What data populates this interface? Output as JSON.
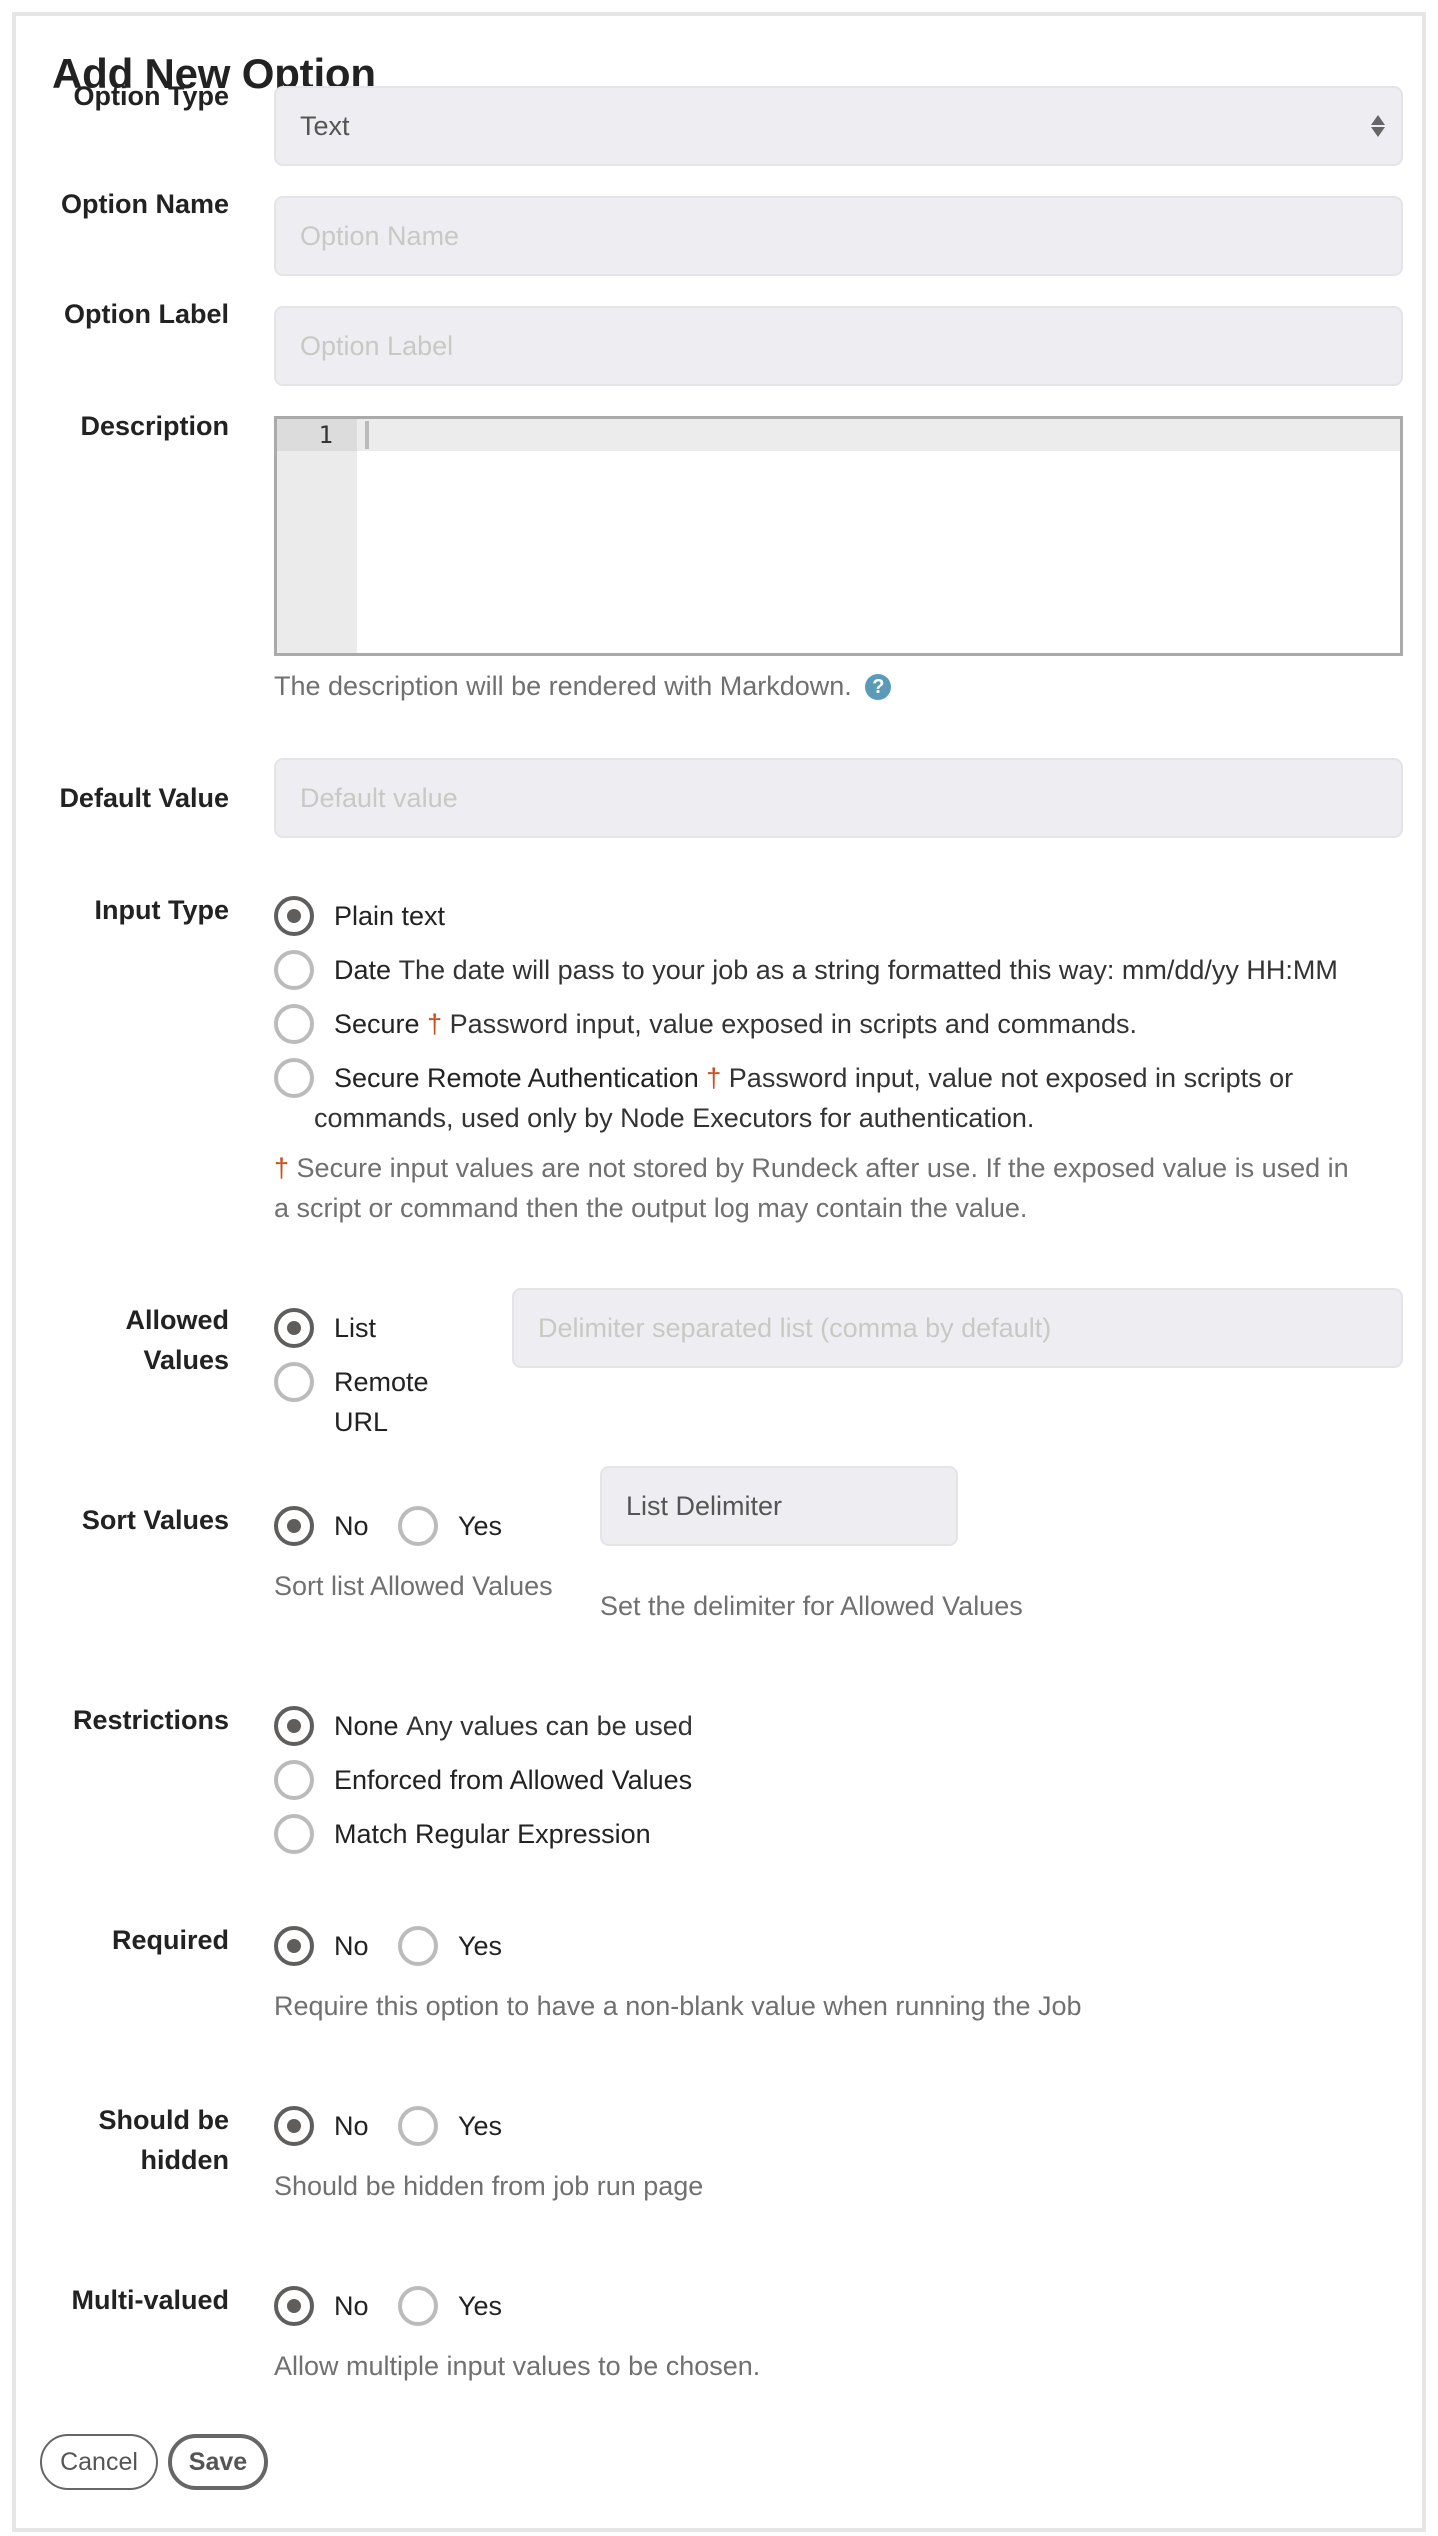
{
  "title": "Add New Option",
  "fields": {
    "option_type": {
      "label": "Option Type",
      "value": "Text"
    },
    "option_name": {
      "label": "Option Name",
      "placeholder": "Option Name",
      "value": ""
    },
    "option_label": {
      "label": "Option Label",
      "placeholder": "Option Label",
      "value": ""
    },
    "description": {
      "label": "Description",
      "line_number": "1",
      "help": "The description will be rendered with Markdown.",
      "help_icon": "question-circle-icon"
    },
    "default_value": {
      "label": "Default Value",
      "placeholder": "Default value",
      "value": ""
    },
    "input_type": {
      "label": "Input Type",
      "options": [
        {
          "label": "Plain text",
          "description": "",
          "dagger": false,
          "checked": true
        },
        {
          "label": "Date",
          "description": "The date will pass to your job as a string formatted this way: mm/dd/yy HH:MM",
          "dagger": false,
          "checked": false
        },
        {
          "label": "Secure",
          "description": "Password input, value exposed in scripts and commands.",
          "dagger": true,
          "checked": false
        },
        {
          "label": "Secure Remote Authentication",
          "description": "Password input, value not exposed in scripts or",
          "description_cont": "commands, used only by Node Executors for authentication.",
          "dagger": true,
          "checked": false
        }
      ],
      "dagger_symbol": "†",
      "note_line1": "Secure input values are not stored by Rundeck after use. If the exposed value is used in",
      "note_line2": "a script or command then the output log may contain the value."
    },
    "allowed_values": {
      "label_line1": "Allowed",
      "label_line2": "Values",
      "options": [
        {
          "label": "List",
          "checked": true
        },
        {
          "label_line1": "Remote",
          "label_line2": "URL",
          "checked": false
        }
      ],
      "placeholder": "Delimiter separated list (comma by default)",
      "value": ""
    },
    "sort_values": {
      "label": "Sort Values",
      "options": [
        {
          "label": "No",
          "checked": true
        },
        {
          "label": "Yes",
          "checked": false
        }
      ],
      "help": "Sort list Allowed Values",
      "delimiter_value": "List Delimiter",
      "delimiter_help": "Set the delimiter for Allowed Values"
    },
    "restrictions": {
      "label": "Restrictions",
      "options": [
        {
          "label": "None",
          "description": "Any values can be used",
          "checked": true
        },
        {
          "label": "Enforced from Allowed Values",
          "description": "",
          "checked": false
        },
        {
          "label": "Match Regular Expression",
          "description": "",
          "checked": false
        }
      ]
    },
    "required": {
      "label": "Required",
      "options": [
        {
          "label": "No",
          "checked": true
        },
        {
          "label": "Yes",
          "checked": false
        }
      ],
      "help": "Require this option to have a non-blank value when running the Job"
    },
    "hidden": {
      "label_line1": "Should be",
      "label_line2": "hidden",
      "options": [
        {
          "label": "No",
          "checked": true
        },
        {
          "label": "Yes",
          "checked": false
        }
      ],
      "help": "Should be hidden from job run page"
    },
    "multivalued": {
      "label": "Multi-valued",
      "options": [
        {
          "label": "No",
          "checked": true
        },
        {
          "label": "Yes",
          "checked": false
        }
      ],
      "help": "Allow multiple input values to be chosen."
    }
  },
  "buttons": {
    "cancel": "Cancel",
    "save": "Save"
  },
  "colors": {
    "accent_dagger": "#c8501e",
    "help_icon": "#5b9bb8",
    "input_bg": "#eeeef2",
    "radio_checked": "#5f5e5c"
  }
}
